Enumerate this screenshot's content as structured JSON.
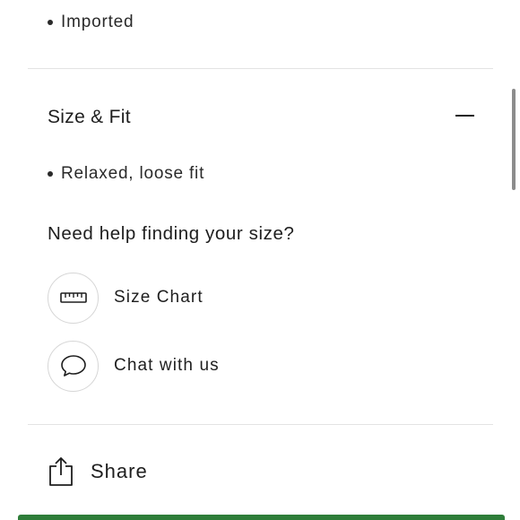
{
  "details": {
    "bullets": [
      "Imported"
    ]
  },
  "size_fit": {
    "title": "Size & Fit",
    "expanded": true,
    "bullets": [
      "Relaxed, loose fit"
    ],
    "help_heading": "Need help finding your size?",
    "options": [
      {
        "label": "Size Chart",
        "icon": "ruler-icon"
      },
      {
        "label": "Chat with us",
        "icon": "chat-bubble-icon"
      }
    ]
  },
  "share": {
    "label": "Share",
    "icon": "share-icon"
  },
  "colors": {
    "accent_green": "#2e7d39",
    "divider": "#e3e3e3"
  }
}
